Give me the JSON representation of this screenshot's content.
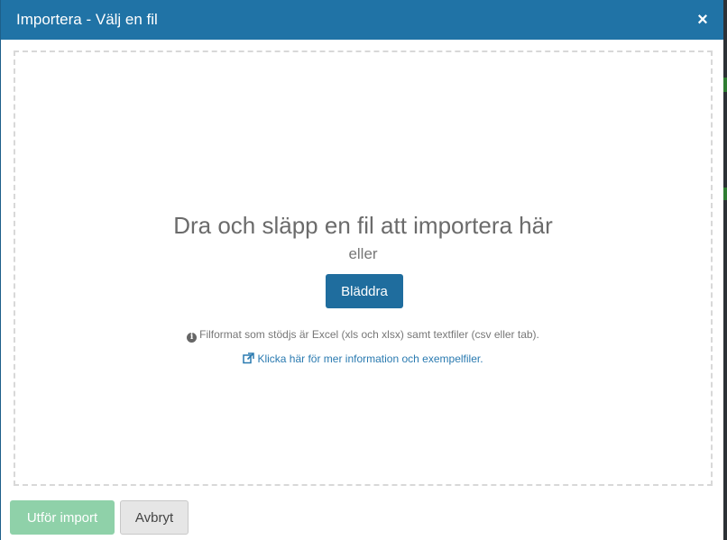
{
  "dialog": {
    "title": "Importera - Välj en fil",
    "close_icon": "×"
  },
  "dropzone": {
    "title": "Dra och släpp en fil att importera här",
    "or_text": "eller",
    "browse_label": "Bläddra",
    "info_icon": "i",
    "info_text": "Filformat som stödjs är Excel (xls och xlsx) samt textfiler (csv eller tab).",
    "link_text": "Klicka här för mer information och exempelfiler."
  },
  "footer": {
    "import_label": "Utför import",
    "cancel_label": "Avbryt"
  },
  "colors": {
    "header": "#2073a6",
    "primary_button": "#1f6d9e",
    "success_disabled": "#8fd1a9",
    "link": "#2a7ab0"
  }
}
